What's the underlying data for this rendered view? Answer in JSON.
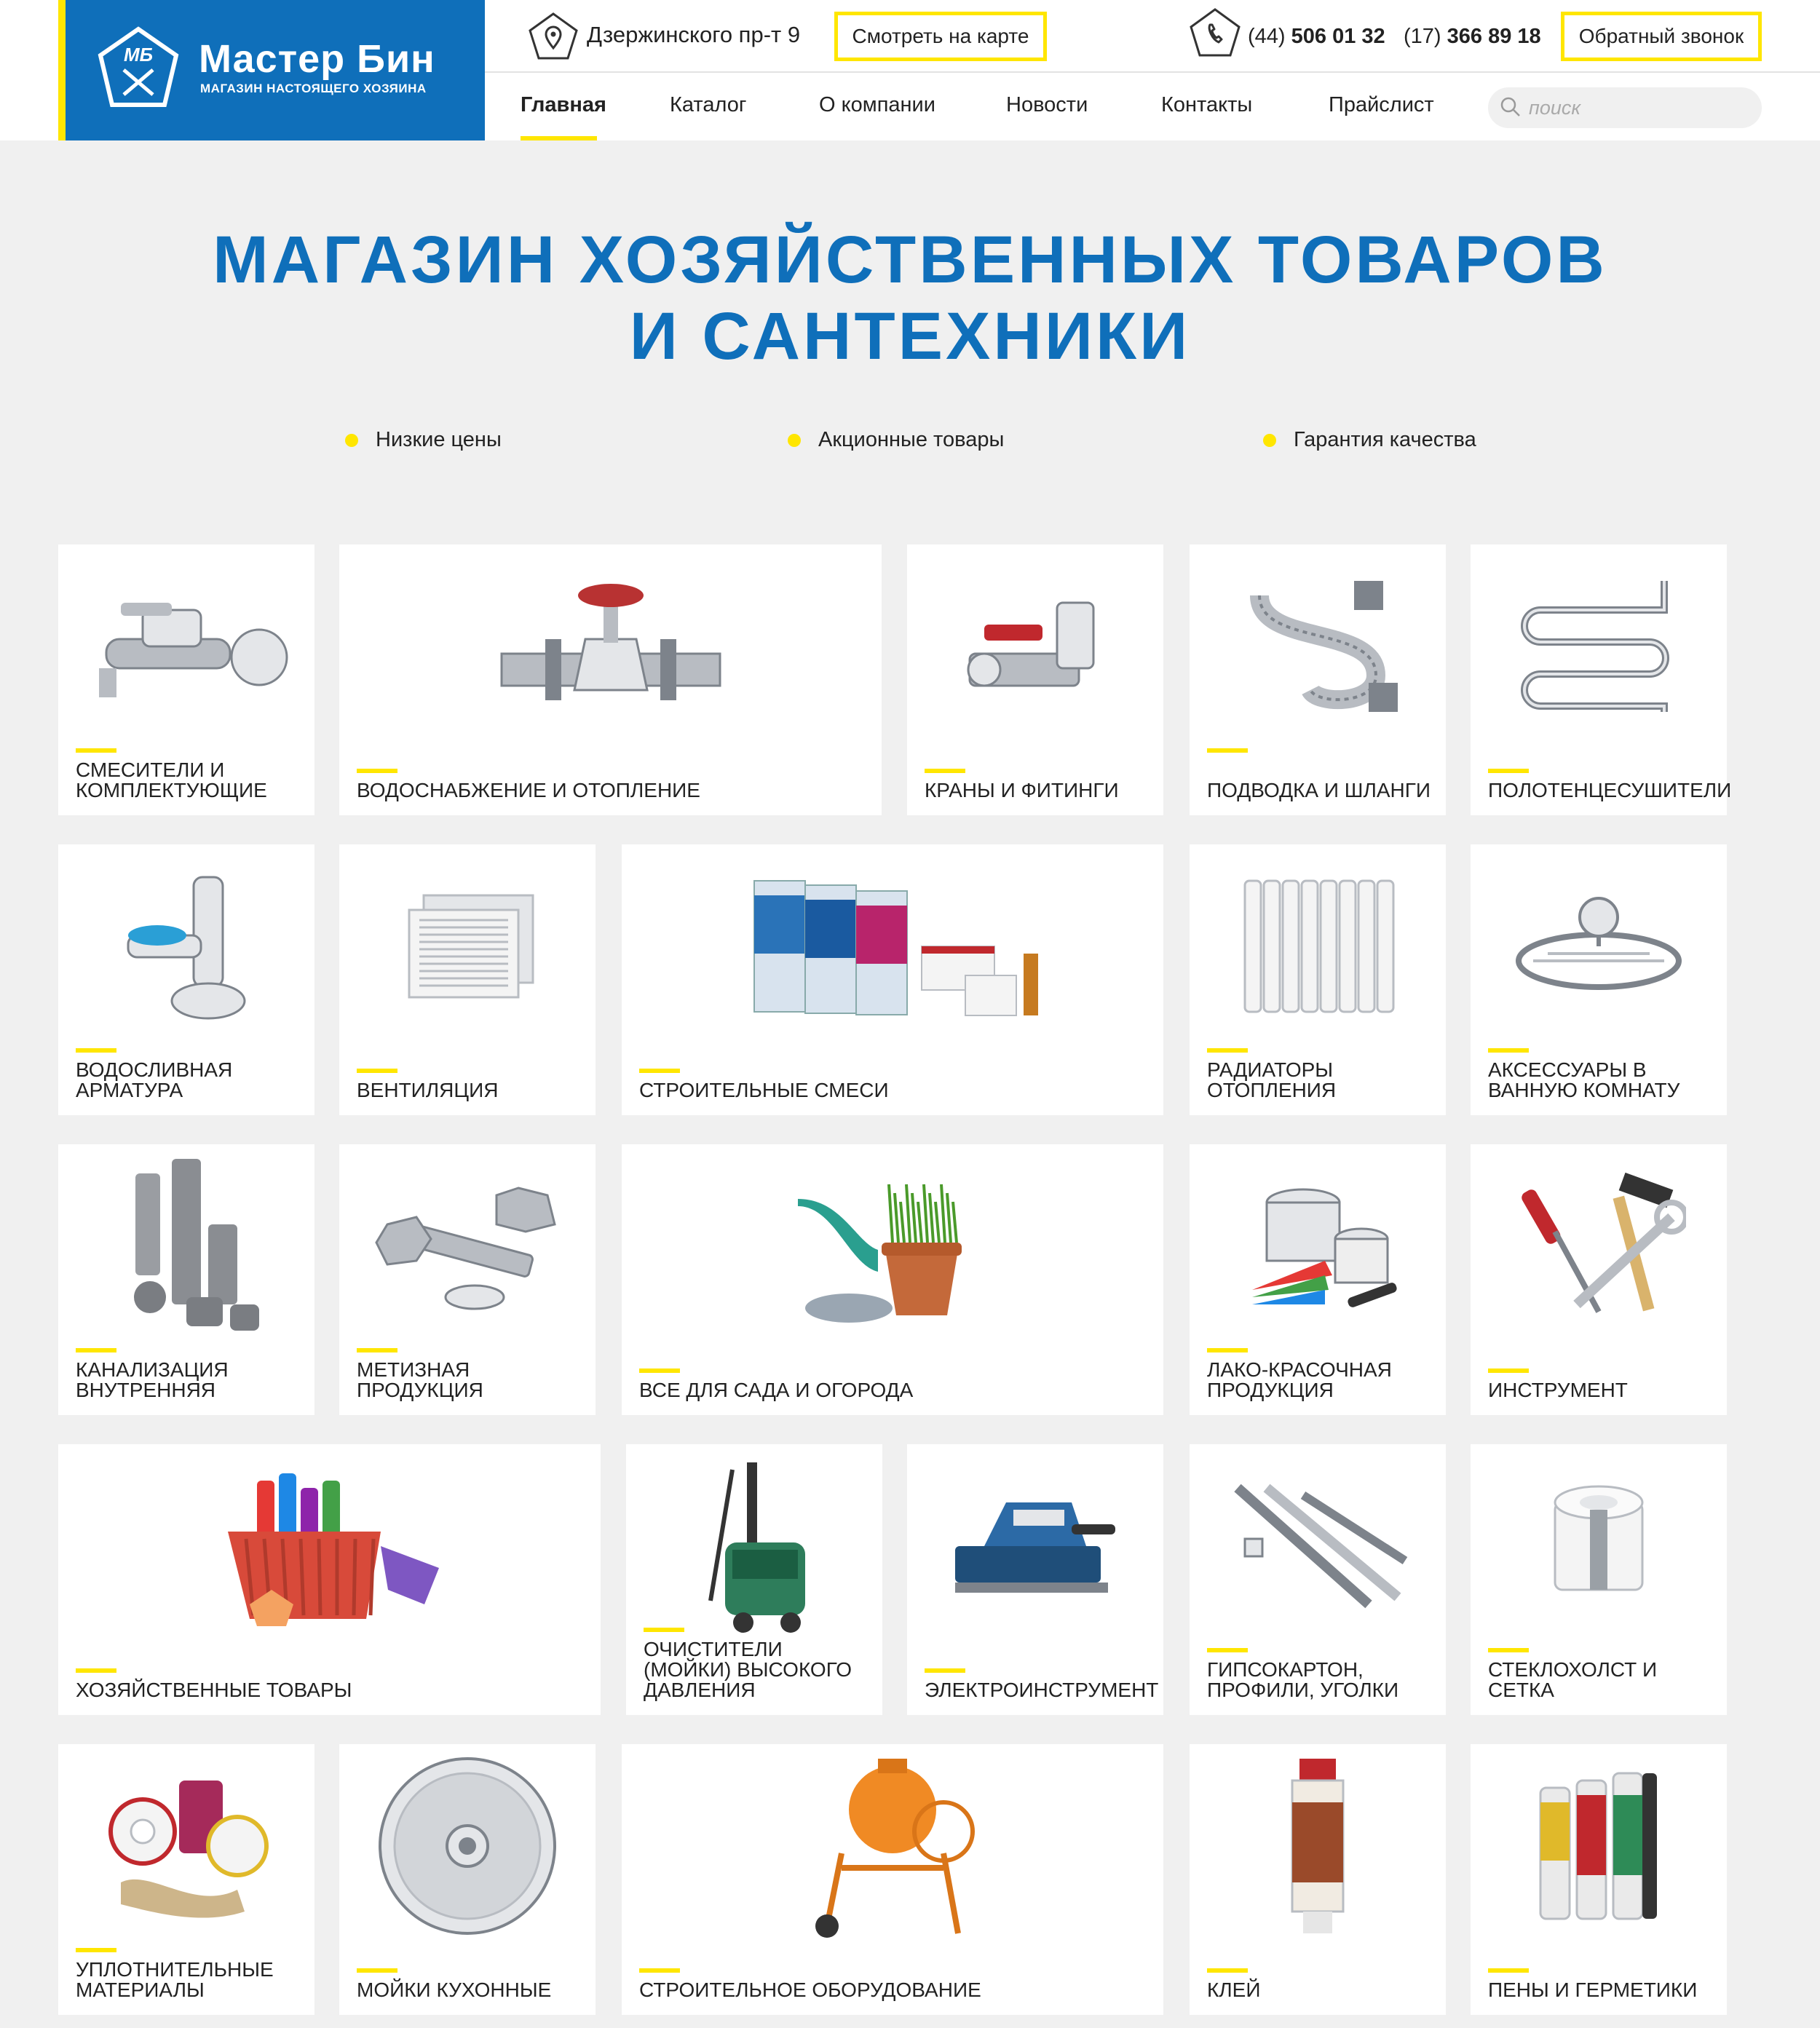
{
  "header": {
    "logo": {
      "title": "Мастер Бин",
      "subtitle": "МАГАЗИН НАСТОЯЩЕГО ХОЗЯИНА",
      "emblem_text": "МБ"
    },
    "address": "Дзержинского пр-т 9",
    "map_button": "Смотреть на карте",
    "phones": [
      {
        "code": "(44)",
        "number": "506 01 32"
      },
      {
        "code": "(17)",
        "number": "366 89 18"
      }
    ],
    "callback_button": "Обратный звонок",
    "nav": [
      "Главная",
      "Каталог",
      "О компании",
      "Новости",
      "Контакты",
      "Прайслист"
    ],
    "active_nav": "Главная",
    "search_placeholder": "поиск"
  },
  "hero": {
    "title_line1": "МАГАЗИН ХОЗЯЙСТВЕННЫХ ТОВАРОВ",
    "title_line2": "И САНТЕХНИКИ",
    "features": [
      "Низкие цены",
      "Акционные товары",
      "Гарантия качества"
    ]
  },
  "colors": {
    "brand_blue": "#0f6fba",
    "accent_yellow": "#ffe600",
    "background": "#f0f0f0"
  },
  "categories": [
    {
      "label": "Смесители и комплектующие",
      "icon": "faucet-icon"
    },
    {
      "label": "Водоснабжение и отопление",
      "icon": "valve-icon"
    },
    {
      "label": "Краны и фитинги",
      "icon": "ball-valve-icon"
    },
    {
      "label": "Подводка и шланги",
      "icon": "hose-icon"
    },
    {
      "label": "Полотенцесушители",
      "icon": "towel-dryer-icon"
    },
    {
      "label": "Водосливная арматура",
      "icon": "siphon-icon"
    },
    {
      "label": "Вентиляция",
      "icon": "vent-grille-icon"
    },
    {
      "label": "Строительные смеси",
      "icon": "mix-bags-icon"
    },
    {
      "label": "Радиаторы отопления",
      "icon": "radiator-icon"
    },
    {
      "label": "Аксессуары в ванную комнату",
      "icon": "soap-dish-icon"
    },
    {
      "label": "Канализация внутренняя",
      "icon": "pipes-icon"
    },
    {
      "label": "Метизная продукция",
      "icon": "bolts-icon"
    },
    {
      "label": "Все для сада и огорода",
      "icon": "watering-can-icon"
    },
    {
      "label": "Лако-красочная продукция",
      "icon": "paint-icon"
    },
    {
      "label": "Инструмент",
      "icon": "tools-icon"
    },
    {
      "label": "Хозяйственные товары",
      "icon": "basket-icon"
    },
    {
      "label": "Очистители (мойки) высокого давления",
      "icon": "pressure-washer-icon"
    },
    {
      "label": "Электроинструмент",
      "icon": "planer-icon"
    },
    {
      "label": "Гипсокартон, профили, уголки",
      "icon": "profiles-icon"
    },
    {
      "label": "Стеклохолст и сетка",
      "icon": "tape-roll-icon"
    },
    {
      "label": "Уплотнительные материалы",
      "icon": "seal-tape-icon"
    },
    {
      "label": "Мойки кухонные",
      "icon": "sink-icon"
    },
    {
      "label": "Строительное оборудование",
      "icon": "concrete-mixer-icon"
    },
    {
      "label": "Клей",
      "icon": "glue-tube-icon"
    },
    {
      "label": "Пены и герметики",
      "icon": "foam-cans-icon"
    }
  ]
}
